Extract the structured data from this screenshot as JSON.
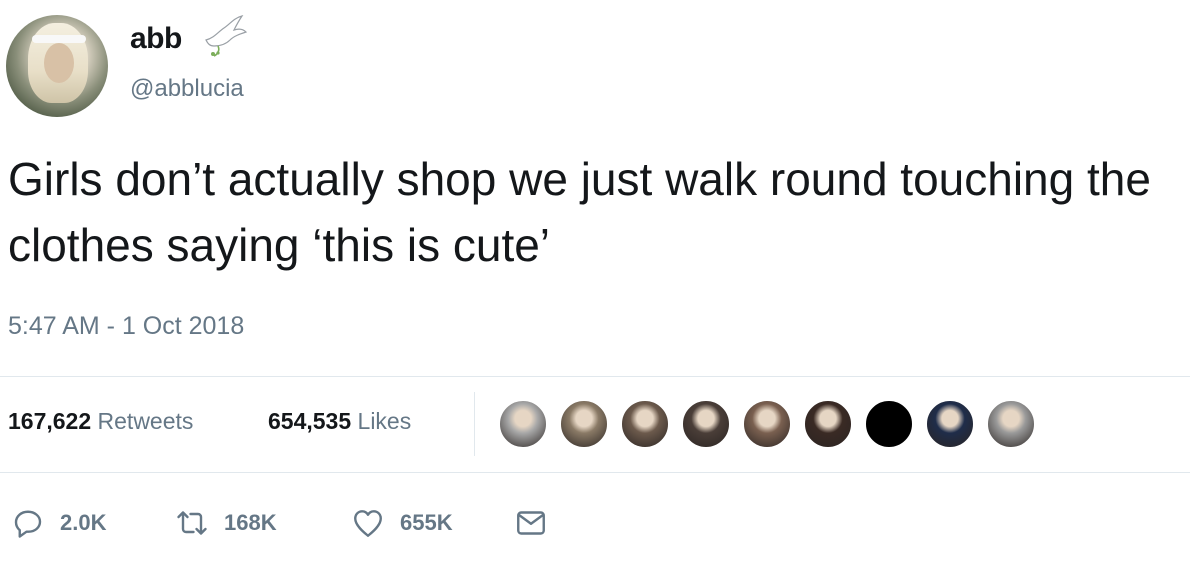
{
  "user": {
    "display_name": "abb",
    "handle": "@abblucia"
  },
  "tweet": {
    "text": "Girls don’t actually shop we just walk round touching the clothes saying ‘this is cute’",
    "timestamp": "5:47 AM - 1 Oct 2018"
  },
  "stats": {
    "retweets_count": "167,622",
    "retweets_label": "Retweets",
    "likes_count": "654,535",
    "likes_label": "Likes"
  },
  "likers": {
    "count": 9,
    "colors": [
      "#a8a8a8",
      "#8a7a66",
      "#6c5a4c",
      "#4a3e38",
      "#7a6050",
      "#3a2a24",
      "#000000",
      "#1f2d4a",
      "#9a9a9a"
    ]
  },
  "actions": {
    "reply_count": "2.0K",
    "retweet_count": "168K",
    "like_count": "655K"
  },
  "colors": {
    "text": "#14171a",
    "secondary": "#657786",
    "divider": "#e1e8ed"
  }
}
